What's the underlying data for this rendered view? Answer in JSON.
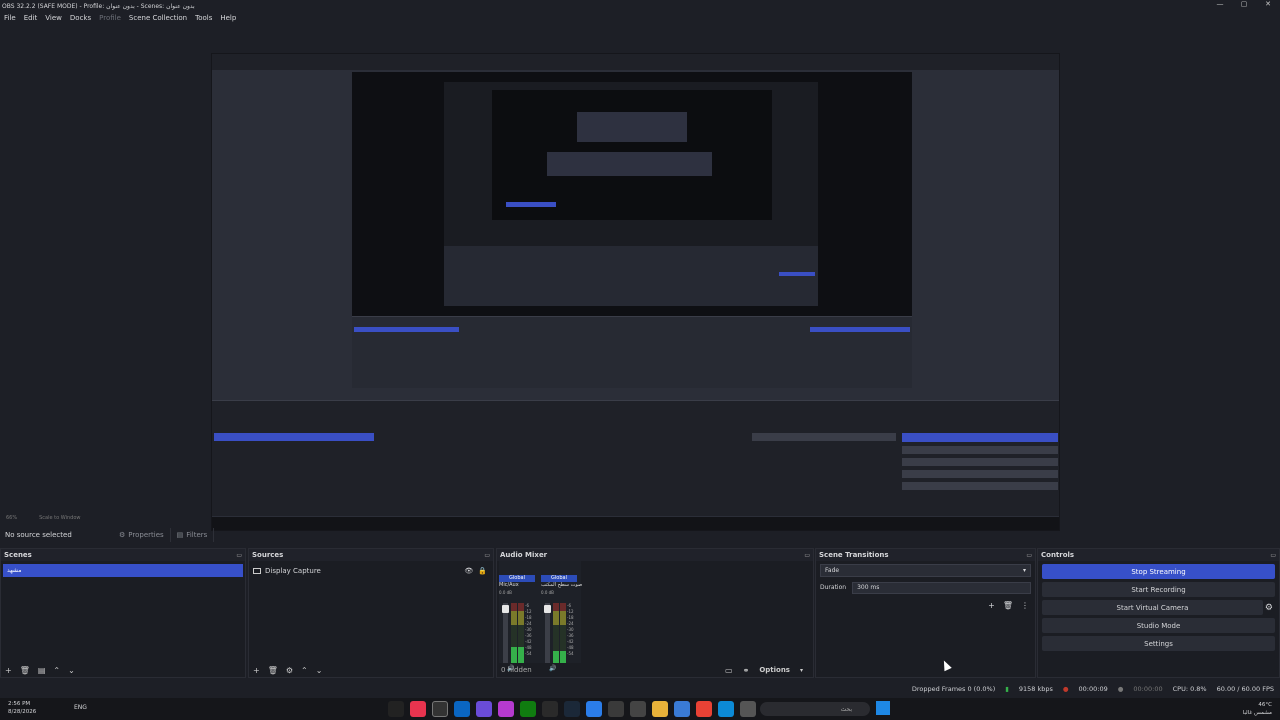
{
  "window": {
    "title": "OBS 32.2.2 (SAFE MODE) - Profile: بدون عنوان - Scenes: بدون عنوان",
    "controls": [
      "—",
      "▢",
      "✕"
    ]
  },
  "menu": [
    "File",
    "Edit",
    "View",
    "Docks",
    "Profile",
    "Scene Collection",
    "Tools",
    "Help"
  ],
  "zoom": {
    "value": "66%",
    "mode": "Scale to Window"
  },
  "properties_bar": {
    "selection": "No source selected",
    "properties": "Properties",
    "filters": "Filters"
  },
  "scenes": {
    "title": "Scenes",
    "items": [
      "مشهد"
    ]
  },
  "sources": {
    "title": "Sources",
    "items": [
      {
        "name": "Display Capture"
      }
    ]
  },
  "mixer": {
    "title": "Audio Mixer",
    "channels": [
      {
        "tag": "Global",
        "name": "Mic/Aux",
        "db": "0.0 dB"
      },
      {
        "tag": "Global",
        "name": "صوت سطح المكتب",
        "db": "0.0 dB"
      }
    ],
    "ticks": [
      "0",
      "-6",
      "-12",
      "-18",
      "-24",
      "-30",
      "-36",
      "-42",
      "-48",
      "-54",
      "-60"
    ],
    "hidden": "0 hidden",
    "options": "Options"
  },
  "transitions": {
    "title": "Scene Transitions",
    "selected": "Fade",
    "duration_label": "Duration",
    "duration_value": "300 ms"
  },
  "controls": {
    "title": "Controls",
    "buttons": [
      "Stop Streaming",
      "Start Recording",
      "Start Virtual Camera",
      "Studio Mode",
      "Settings"
    ]
  },
  "status": {
    "dropped": "Dropped Frames 0 (0.0%)",
    "bitrate": "9158 kbps",
    "live_time": "00:00:09",
    "rec_time": "00:00:00",
    "cpu": "CPU: 0.8%",
    "fps": "60.00 / 60.00 FPS"
  },
  "taskbar": {
    "time": "2:56 PM",
    "date": "8/28/2026",
    "lang": "ENG",
    "search_placeholder": "بحث",
    "weather_temp": "46°C",
    "weather_desc": "مشمس غالبا"
  },
  "colors": {
    "accent": "#3750c9",
    "bg": "#1d1f26",
    "dock": "#1b1d23"
  }
}
